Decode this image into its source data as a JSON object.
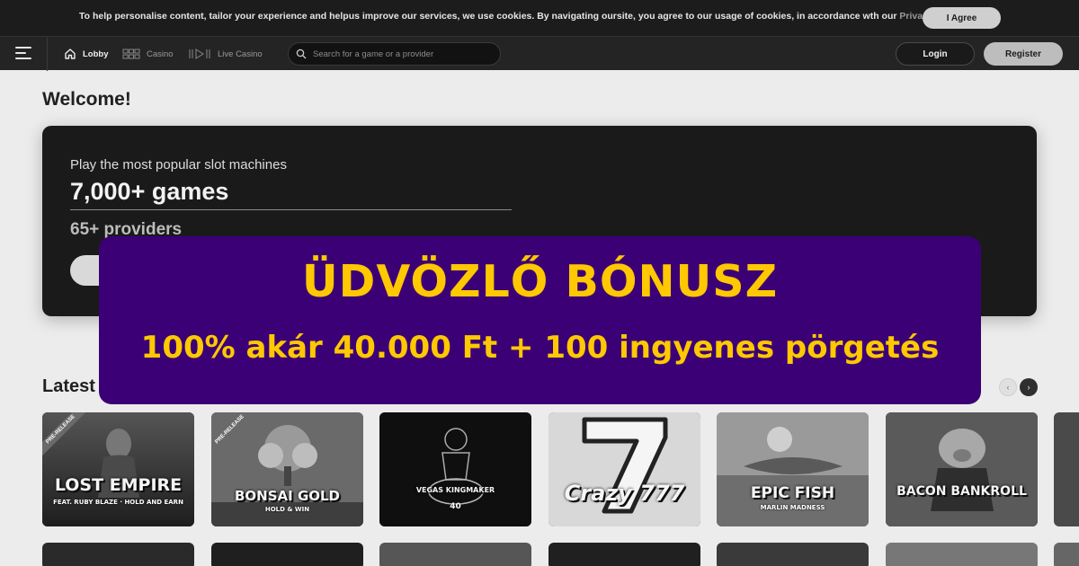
{
  "cookie": {
    "text": "To help personalise content, tailor your experience and helpus improve our services, we use cookies. By navigating oursite, you agree to our usage of cookies, in accordance wth our ",
    "link": "Privacy Policy.",
    "agree_label": "I Agree"
  },
  "nav": {
    "items": [
      {
        "label": "Lobby",
        "icon": "home-icon"
      },
      {
        "label": "Casino",
        "icon": "grid-icon"
      },
      {
        "label": "Live Casino",
        "icon": "play-icon"
      }
    ],
    "search_placeholder": "Search for a game or a provider",
    "login_label": "Login",
    "register_label": "Register"
  },
  "main": {
    "welcome": "Welcome!",
    "hero": {
      "subtitle": "Play the most popular slot machines",
      "games": "7,000+ games",
      "providers": "65+ providers"
    },
    "latest_title": "Latest",
    "arrows": {
      "prev": "‹",
      "next": "›"
    }
  },
  "promo": {
    "title": "ÜDVÖZLŐ BÓNUSZ",
    "offer": "100% akár 40.000 Ft + 100 ingyenes pörgetés"
  },
  "games": [
    {
      "title": "LOST EMPIRE",
      "subtitle": "FEAT. RUBY BLAZE · HOLD AND EARN",
      "badge": "PRE-RELEASE"
    },
    {
      "title": "BONSAI GOLD",
      "subtitle": "HOLD & WIN",
      "badge": "PRE-RELEASE"
    },
    {
      "title": "VEGAS KINGMAKER",
      "subtitle": "40",
      "badge": ""
    },
    {
      "title": "Crazy 777",
      "subtitle": "",
      "badge": ""
    },
    {
      "title": "EPIC FISH",
      "subtitle": "MARLIN MADNESS",
      "badge": ""
    },
    {
      "title": "BACON BANKROLL",
      "subtitle": "",
      "badge": ""
    }
  ]
}
